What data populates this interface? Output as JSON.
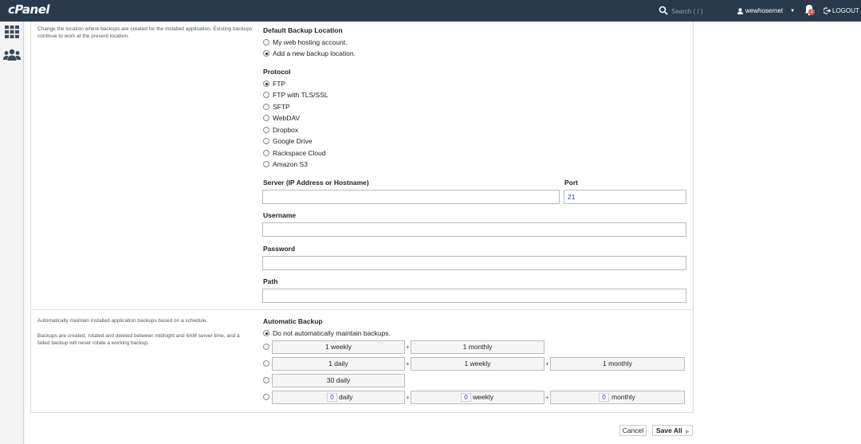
{
  "header": {
    "logo": "cPanel",
    "search_placeholder": "Search ( / )",
    "username": "wewhosernet",
    "notification_count": "1",
    "logout_label": "LOGOUT"
  },
  "sidebar": {
    "items": [
      {
        "icon": "grid-icon"
      },
      {
        "icon": "users-icon"
      }
    ]
  },
  "backup_location": {
    "description": "Change the location where backups are created for the installed application. Existing backups continue to work at the present location.",
    "heading": "Default Backup Location",
    "options": [
      "My web hosting account.",
      "Add a new backup location."
    ],
    "selected": "Add a new backup location."
  },
  "protocol": {
    "heading": "Protocol",
    "options": [
      "FTP",
      "FTP with TLS/SSL",
      "SFTP",
      "WebDAV",
      "Dropbox",
      "Google Drive",
      "Rackspace Cloud",
      "Amazon S3"
    ],
    "selected": "FTP"
  },
  "fields": {
    "server_label": "Server (IP Address or Hostname)",
    "server_value": "",
    "port_label": "Port",
    "port_value": "21",
    "username_label": "Username",
    "username_value": "",
    "password_label": "Password",
    "password_value": "",
    "path_label": "Path",
    "path_value": ""
  },
  "automatic_backup": {
    "description_1": "Automatically maintain installed application backups based on a schedule.",
    "description_2": "Backups are created, rotated and deleted between midnight and 6AM server time, and a failed backup will never rotate a working backup.",
    "heading": "Automatic Backup",
    "no_auto_label": "Do not automatically maintain backups.",
    "plan_1": [
      "1 weekly",
      "1 monthly"
    ],
    "plan_2": [
      "1 daily",
      "1 weekly",
      "1 monthly"
    ],
    "plan_3": [
      "30 daily"
    ],
    "custom": {
      "daily_value": "0",
      "daily_label": "daily",
      "weekly_value": "0",
      "weekly_label": "weekly",
      "monthly_value": "0",
      "monthly_label": "monthly"
    },
    "plus": "+"
  },
  "actions": {
    "cancel": "Cancel",
    "save_all": "Save All"
  }
}
